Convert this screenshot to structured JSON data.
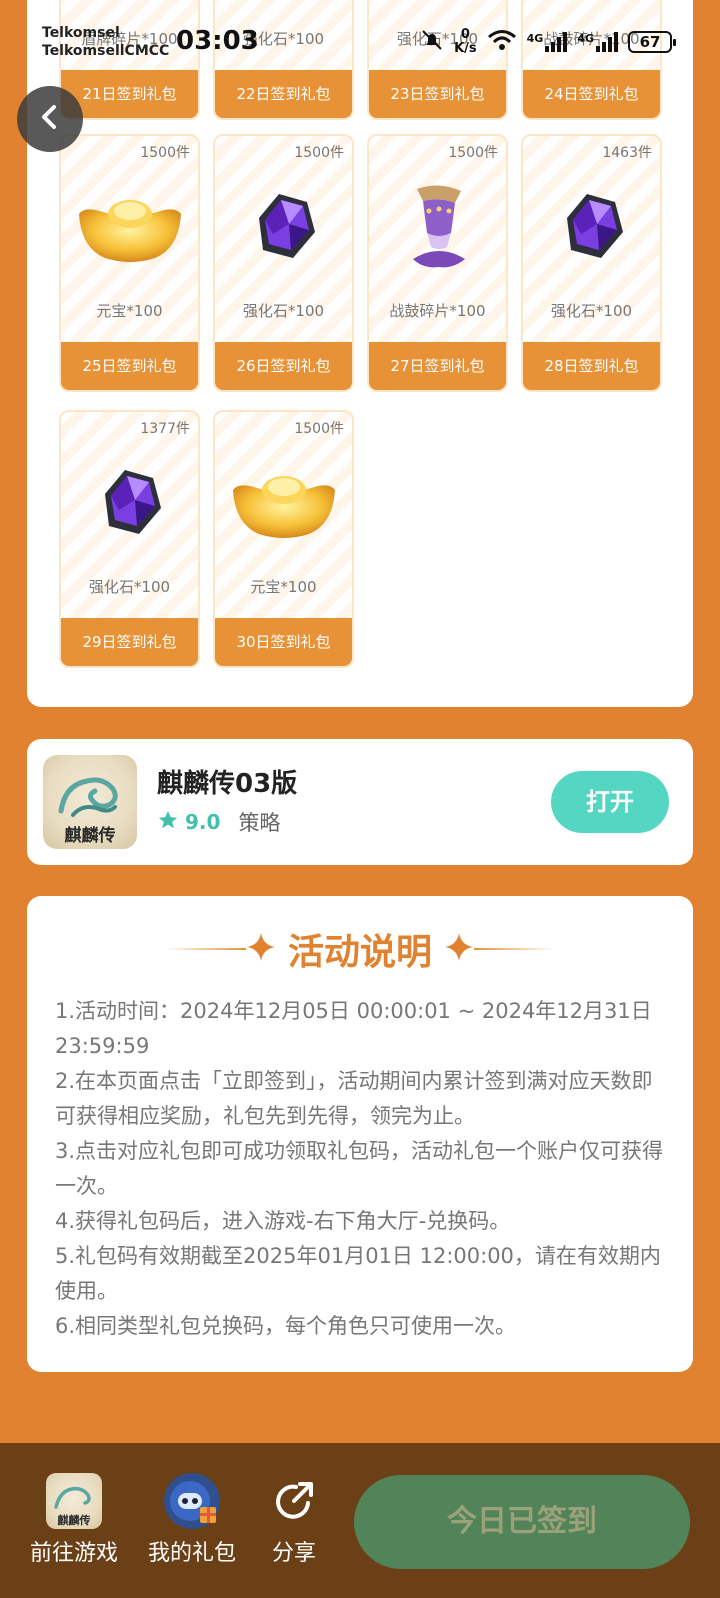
{
  "status_bar": {
    "carrier1": "Telkomsel",
    "carrier2": "TelkomsellCMCC",
    "time": "03:03",
    "speed_value": "0",
    "speed_unit": "K/s",
    "network1": "4G",
    "network2": "4G",
    "battery": "67"
  },
  "top_cut_row": [
    {
      "name": "盾牌碎片*100",
      "day": "21日签到礼包"
    },
    {
      "name": "强化石*100",
      "day": "22日签到礼包"
    },
    {
      "name": "强化石*100",
      "day": "23日签到礼包"
    },
    {
      "name": "战鼓碎片*100",
      "day": "24日签到礼包"
    }
  ],
  "gifts": [
    {
      "count": "1500件",
      "name": "元宝*100",
      "day": "25日签到礼包",
      "icon": "gold-ingot"
    },
    {
      "count": "1500件",
      "name": "强化石*100",
      "day": "26日签到礼包",
      "icon": "purple-gem"
    },
    {
      "count": "1500件",
      "name": "战鼓碎片*100",
      "day": "27日签到礼包",
      "icon": "war-drum"
    },
    {
      "count": "1463件",
      "name": "强化石*100",
      "day": "28日签到礼包",
      "icon": "purple-gem"
    },
    {
      "count": "1377件",
      "name": "强化石*100",
      "day": "29日签到礼包",
      "icon": "purple-gem"
    },
    {
      "count": "1500件",
      "name": "元宝*100",
      "day": "30日签到礼包",
      "icon": "gold-ingot"
    }
  ],
  "game": {
    "title": "麒麟传03版",
    "score": "9.0",
    "genre": "策略",
    "open_label": "打开",
    "icon_text": "麒麟传"
  },
  "rules": {
    "title": "活动说明",
    "items": [
      "1.活动时间：2024年12月05日 00:00:01 ~ 2024年12月31日 23:59:59",
      "2.在本页面点击「立即签到」，活动期间内累计签到满对应天数即可获得相应奖励，礼包先到先得，领完为止。",
      "3.点击对应礼包即可成功领取礼包码，活动礼包一个账户仅可获得一次。",
      "4.获得礼包码后，进入游戏-右下角大厅-兑换码。",
      "5.礼包码有效期截至2025年01月01日 12:00:00，请在有效期内使用。",
      "6.相同类型礼包兑换码，每个角色只可使用一次。"
    ]
  },
  "bottom_bar": {
    "goto_game": "前往游戏",
    "my_gifts": "我的礼包",
    "share": "分享",
    "signed": "今日已签到",
    "game_icon_text": "麒麟传"
  },
  "colors": {
    "background": "#e0822f",
    "card_band": "#e79236",
    "accent_teal": "#55d6c2",
    "bottom_bar": "#6c4016",
    "signed_button": "#538358"
  }
}
